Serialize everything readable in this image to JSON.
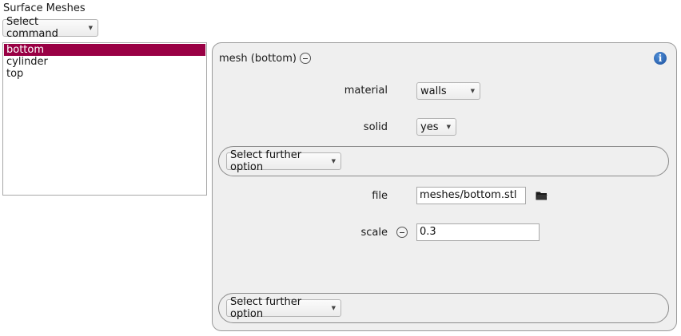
{
  "window_title": "Surface Meshes",
  "command_select": {
    "value": "Select command"
  },
  "mesh_list": {
    "items": [
      "bottom",
      "cylinder",
      "top"
    ],
    "selected_index": 0
  },
  "mesh_panel": {
    "header": "mesh (bottom)",
    "info_icon": "info-icon",
    "fields": {
      "material": {
        "label": "material",
        "value": "walls"
      },
      "solid": {
        "label": "solid",
        "value": "yes"
      },
      "file": {
        "label": "file",
        "value": "meshes/bottom.stl",
        "icon": "folder-icon"
      },
      "scale": {
        "label": "scale",
        "value": "0.3"
      }
    },
    "further_option_top": "Select further option",
    "further_option_bottom": "Select further option"
  },
  "colors": {
    "selection": "#990044",
    "panel_bg": "#efefef",
    "info_blue": "#1c4f9c"
  }
}
